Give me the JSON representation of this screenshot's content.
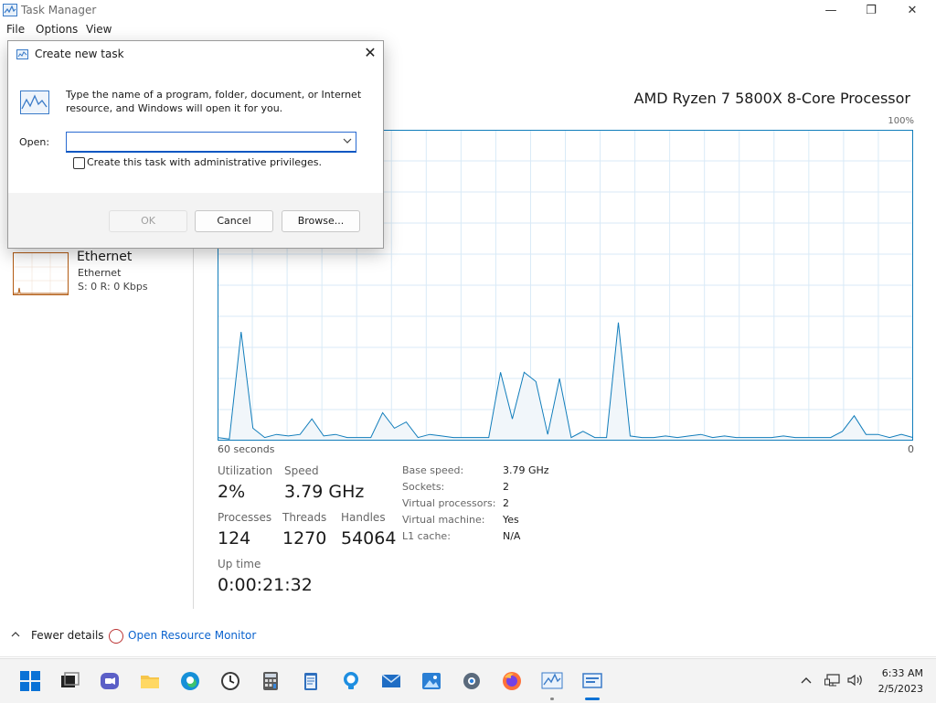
{
  "window": {
    "title": "Task Manager",
    "minimize": "—",
    "maximize": "❐",
    "close": "✕"
  },
  "menu": [
    "File",
    "Options",
    "View"
  ],
  "sidebar": {
    "ethernet": {
      "title": "Ethernet",
      "subtitle": "Ethernet",
      "speed": "S: 0 R: 0 Kbps"
    }
  },
  "cpu": {
    "name": "AMD Ryzen 7 5800X 8-Core Processor",
    "max_label": "100%",
    "time_label": "60 seconds",
    "min_label": "0",
    "stats": {
      "utilization_label": "Utilization",
      "utilization": "2%",
      "speed_label": "Speed",
      "speed": "3.79 GHz",
      "processes_label": "Processes",
      "processes": "124",
      "threads_label": "Threads",
      "threads": "1270",
      "handles_label": "Handles",
      "handles": "54064",
      "uptime_label": "Up time",
      "uptime": "0:00:21:32"
    },
    "details": [
      {
        "label": "Base speed:",
        "value": "3.79 GHz"
      },
      {
        "label": "Sockets:",
        "value": "2"
      },
      {
        "label": "Virtual processors:",
        "value": "2"
      },
      {
        "label": "Virtual machine:",
        "value": "Yes"
      },
      {
        "label": "L1 cache:",
        "value": "N/A"
      }
    ]
  },
  "chart_data": {
    "type": "area",
    "ylim": [
      0,
      100
    ],
    "values": [
      1,
      0.5,
      35,
      4,
      1,
      2,
      1.5,
      2,
      7,
      1.5,
      2,
      1,
      1,
      1,
      9,
      4,
      6,
      1,
      2,
      1.5,
      1,
      1,
      1,
      1,
      22,
      7,
      22,
      19,
      2,
      20,
      1,
      3,
      1,
      1,
      38,
      1.5,
      1,
      1,
      1.5,
      1,
      1.5,
      2,
      1,
      1.5,
      1,
      1,
      1,
      1,
      1.5,
      1,
      1,
      1,
      1,
      3,
      8,
      2,
      2,
      1,
      2,
      1
    ]
  },
  "footer": {
    "fewer_details": "Fewer details",
    "resource_monitor": "Open Resource Monitor"
  },
  "dialog": {
    "title": "Create new task",
    "description": "Type the name of a program, folder, document, or Internet resource, and Windows will open it for you.",
    "open_label": "Open:",
    "open_value": "",
    "admin_label": "Create this task with administrative privileges.",
    "ok": "OK",
    "cancel": "Cancel",
    "browse": "Browse..."
  },
  "taskbar": {
    "time": "6:33 AM",
    "date": "2/5/2023"
  },
  "colors": {
    "graph_line": "#117dbb",
    "graph_fill": "#f1f6fa",
    "accent": "#0b63ce",
    "ethernet": "#b35c14"
  }
}
